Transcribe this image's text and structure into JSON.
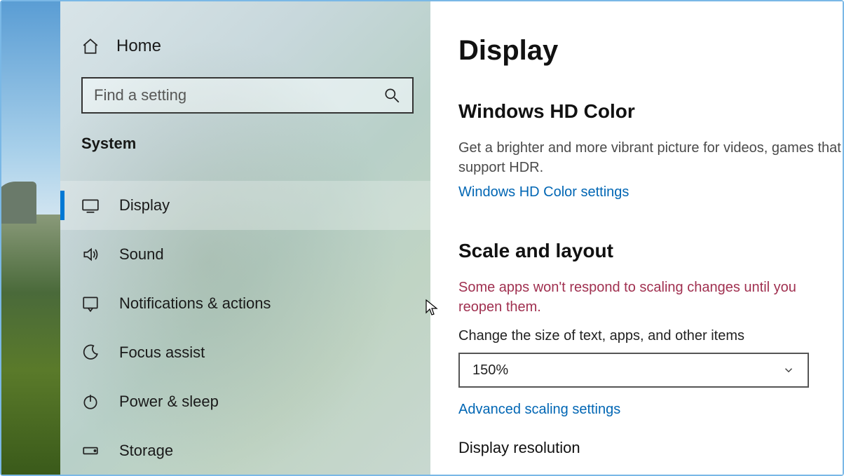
{
  "sidebar": {
    "home_label": "Home",
    "search_placeholder": "Find a setting",
    "category_label": "System",
    "items": [
      {
        "label": "Display"
      },
      {
        "label": "Sound"
      },
      {
        "label": "Notifications & actions"
      },
      {
        "label": "Focus assist"
      },
      {
        "label": "Power & sleep"
      },
      {
        "label": "Storage"
      }
    ]
  },
  "content": {
    "page_title": "Display",
    "hd_color": {
      "title": "Windows HD Color",
      "desc": "Get a brighter and more vibrant picture for videos, games that support HDR.",
      "link": "Windows HD Color settings"
    },
    "scale": {
      "title": "Scale and layout",
      "warning": "Some apps won't respond to scaling changes until you reopen them.",
      "field_label": "Change the size of text, apps, and other items",
      "value": "150%",
      "advanced_link": "Advanced scaling settings"
    },
    "resolution_label": "Display resolution"
  }
}
